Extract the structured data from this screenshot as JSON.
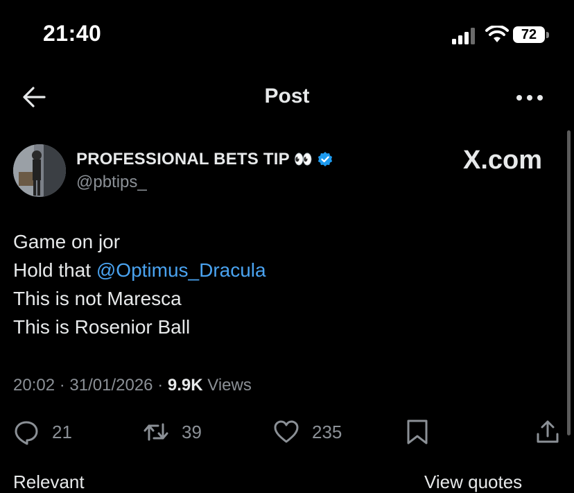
{
  "status_bar": {
    "time": "21:40",
    "battery_level": "72"
  },
  "header": {
    "title": "Post"
  },
  "author": {
    "name": "PROFESSIONAL BETS TIP",
    "emoji": "👀",
    "handle": "@pbtips_"
  },
  "watermark": "X.com",
  "tweet": {
    "line1": "Game on jor",
    "line2_prefix": "Hold that ",
    "line2_mention": "@Optimus_Dracula",
    "line3": "This is not Maresca",
    "line4": "This is Rosenior Ball"
  },
  "meta": {
    "time": "20:02",
    "date": "31/01/2026",
    "views_count": "9.9K",
    "views_label": "Views",
    "sep": "·"
  },
  "actions": {
    "replies": "21",
    "reposts": "39",
    "likes": "235"
  },
  "partial_bottom": {
    "left": "Relevant",
    "right": "View quotes"
  },
  "colors": {
    "background": "#000000",
    "text": "#e7e9ea",
    "muted": "#8b9096",
    "link": "#4aa3f0",
    "verified": "#1d9bf0"
  }
}
